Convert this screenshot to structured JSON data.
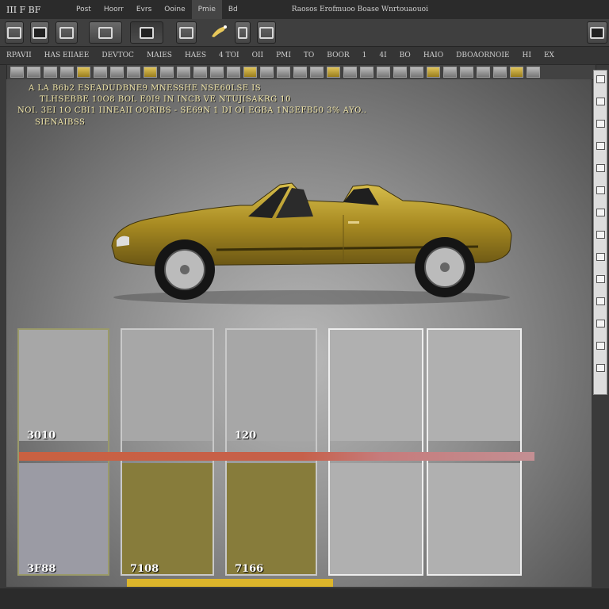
{
  "titlebar": {
    "app_name": "III  F  BF",
    "menu_tabs": [
      "Post",
      "Hoorr",
      "Evrs",
      "Ooine",
      "Pmie",
      "Bd"
    ],
    "active_tab_index": 4,
    "doc_title": "Raosos  Erofmuoo  Boase  Wnrtouaouoi"
  },
  "toolbar": {
    "buttons": [
      {
        "name": "frame-tool-icon",
        "pressed": false
      },
      {
        "name": "image-tool-icon",
        "pressed": false
      },
      {
        "name": "grid-tool-icon",
        "pressed": false
      },
      {
        "name": "layout-tool-icon",
        "pressed": false
      },
      {
        "name": "select-tool-icon",
        "pressed": true
      },
      {
        "name": "crop-tool-icon",
        "pressed": false
      },
      {
        "name": "brush-tool-icon",
        "pressed": false
      },
      {
        "name": "doc-tool-icon",
        "pressed": false
      },
      {
        "name": "pages-tool-icon",
        "pressed": false
      },
      {
        "name": "window-tool-icon",
        "pressed": false
      }
    ]
  },
  "options_bar": {
    "items": [
      "RPAVII",
      "HAS EIIAEE",
      "DEVTOC",
      "MAIES",
      "HAES",
      "4 TOI",
      "OII",
      "PMI",
      "TO",
      "BOOR",
      "1",
      "4I",
      "BO",
      "HAIO",
      "DBOAORNOIE",
      "HI",
      "EX"
    ]
  },
  "canvas_text": {
    "line1": "A  LA  B6b2  ESEADUDBNE9  MNESSHE  NSE60LSE  IS",
    "line2": "TLHSEBBE  10O8  BOL  E0I9  IN  INCB  VE  NTUJISAKRG  10",
    "line3": "NOI.  3EI  1O  CBI1  IINEAII  OORIBS  -  SE69N  1   DI  OI  EGBA  1N3EFB50  3%  AYO..",
    "line4": "SIENAIBSS"
  },
  "cards": {
    "items": [
      {
        "top_label": "3010",
        "bottom_label": "3F88"
      },
      {
        "top_label": "",
        "bottom_label": "7108"
      },
      {
        "top_label": "120",
        "bottom_label": "7166"
      },
      {
        "top_label": "",
        "bottom_label": ""
      },
      {
        "top_label": "",
        "bottom_label": ""
      }
    ]
  },
  "colors": {
    "car_body": "#b99b2a",
    "band_red": "#c96141",
    "card_olive": "#877c3b",
    "gold_bar": "#dcb52b"
  }
}
